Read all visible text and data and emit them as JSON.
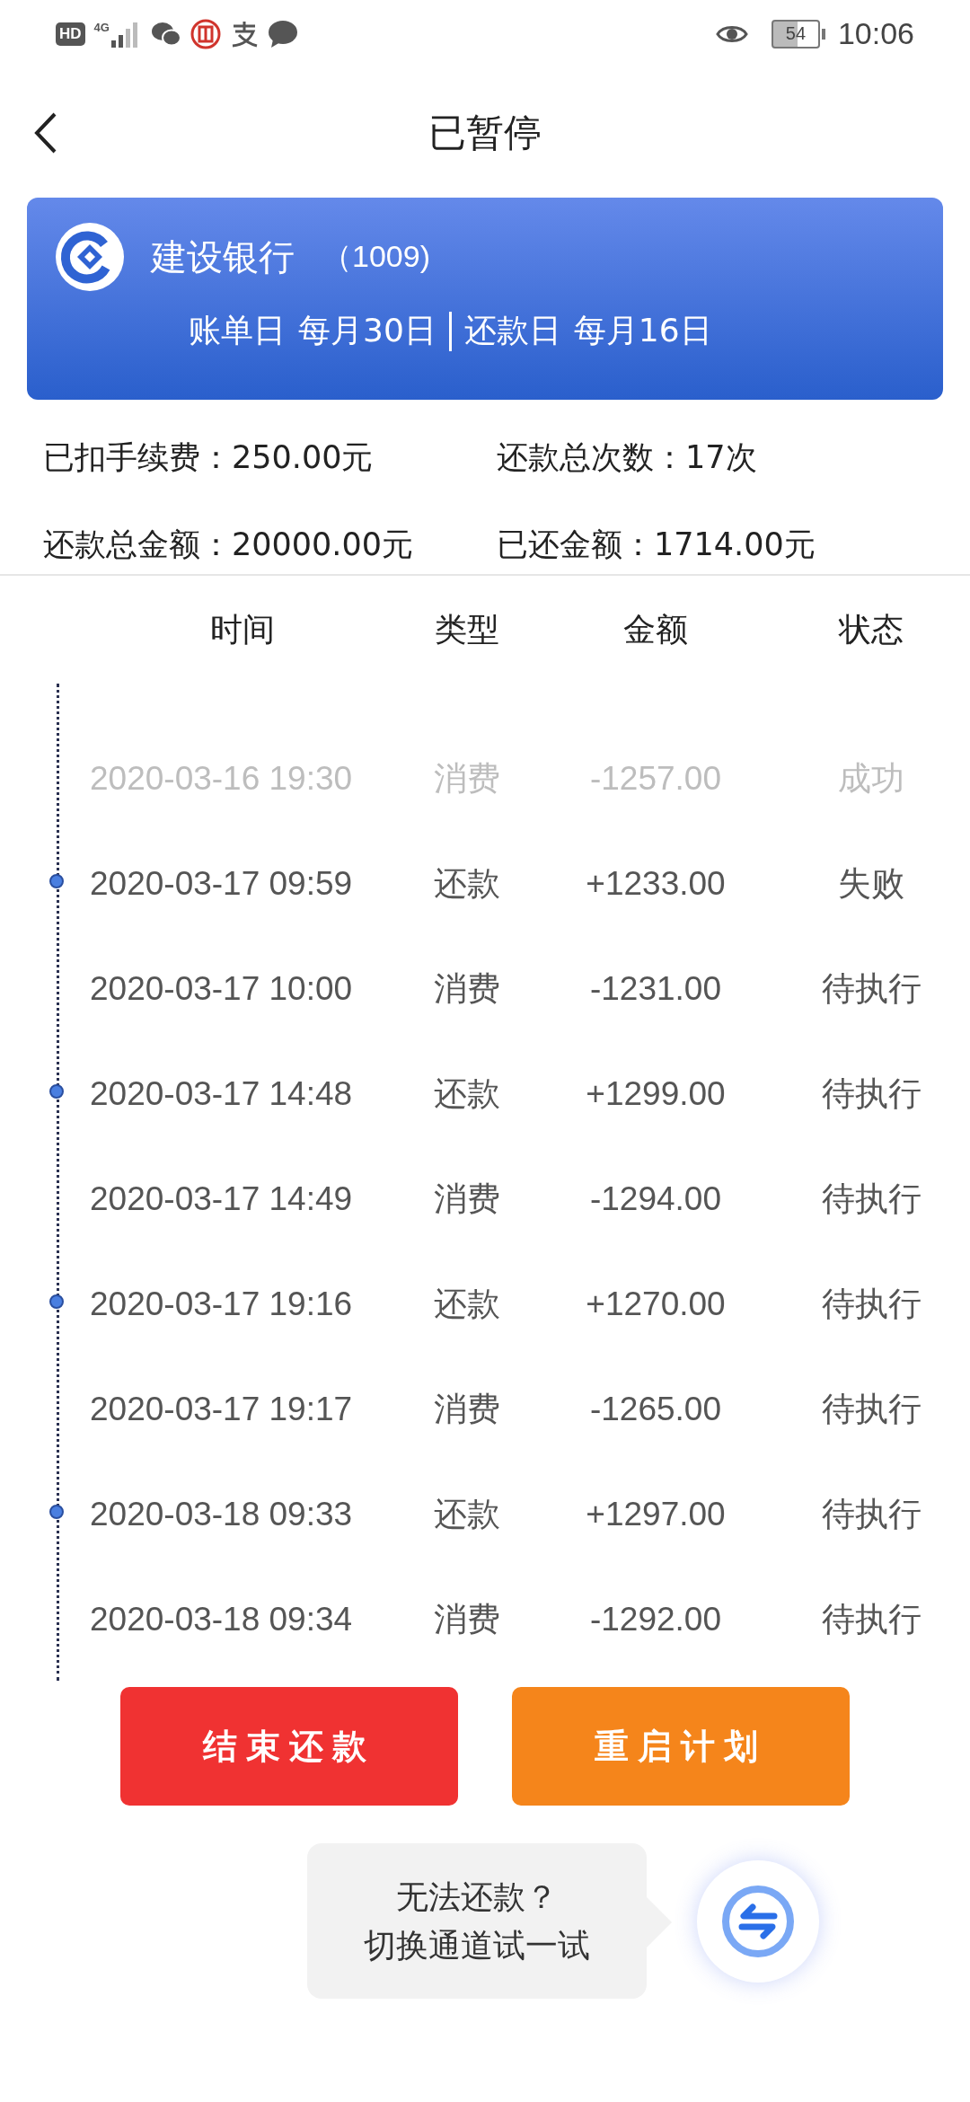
{
  "status_bar": {
    "hd": "HD",
    "network": "4G",
    "battery": "54",
    "time": "10:06"
  },
  "header": {
    "title": "已暂停"
  },
  "card": {
    "bank": "建设银行",
    "card_tail": "（1009)",
    "bill_day_label": "账单日",
    "bill_day": "每月30日",
    "repay_day_label": "还款日",
    "repay_day": "每月16日"
  },
  "stats": [
    {
      "label": "已扣手续费：",
      "value": "250.00元"
    },
    {
      "label": "还款总次数：",
      "value": "17次"
    },
    {
      "label": "还款总金额：",
      "value": "20000.00元"
    },
    {
      "label": "已还金额：",
      "value": "1714.00元"
    }
  ],
  "table": {
    "columns": [
      "时间",
      "类型",
      "金额",
      "状态"
    ],
    "rows": [
      {
        "kind": "consume",
        "completed": true,
        "time": "2020-03-16 19:30",
        "type": "消费",
        "amount": "-1257.00",
        "status": "成功"
      },
      {
        "kind": "repay",
        "completed": false,
        "time": "2020-03-17 09:59",
        "type": "还款",
        "amount": "+1233.00",
        "status": "失败"
      },
      {
        "kind": "consume",
        "completed": false,
        "time": "2020-03-17 10:00",
        "type": "消费",
        "amount": "-1231.00",
        "status": "待执行"
      },
      {
        "kind": "repay",
        "completed": false,
        "time": "2020-03-17 14:48",
        "type": "还款",
        "amount": "+1299.00",
        "status": "待执行"
      },
      {
        "kind": "consume",
        "completed": false,
        "time": "2020-03-17 14:49",
        "type": "消费",
        "amount": "-1294.00",
        "status": "待执行"
      },
      {
        "kind": "repay",
        "completed": false,
        "time": "2020-03-17 19:16",
        "type": "还款",
        "amount": "+1270.00",
        "status": "待执行"
      },
      {
        "kind": "consume",
        "completed": false,
        "time": "2020-03-17 19:17",
        "type": "消费",
        "amount": "-1265.00",
        "status": "待执行"
      },
      {
        "kind": "repay",
        "completed": false,
        "time": "2020-03-18 09:33",
        "type": "还款",
        "amount": "+1297.00",
        "status": "待执行"
      },
      {
        "kind": "consume",
        "completed": false,
        "time": "2020-03-18 09:34",
        "type": "消费",
        "amount": "-1292.00",
        "status": "待执行"
      }
    ]
  },
  "buttons": [
    {
      "kind": "end",
      "label": "结束还款"
    },
    {
      "kind": "restart",
      "label": "重启计划"
    }
  ],
  "help": {
    "line1": "无法还款？",
    "line2": "切换通道试一试"
  }
}
